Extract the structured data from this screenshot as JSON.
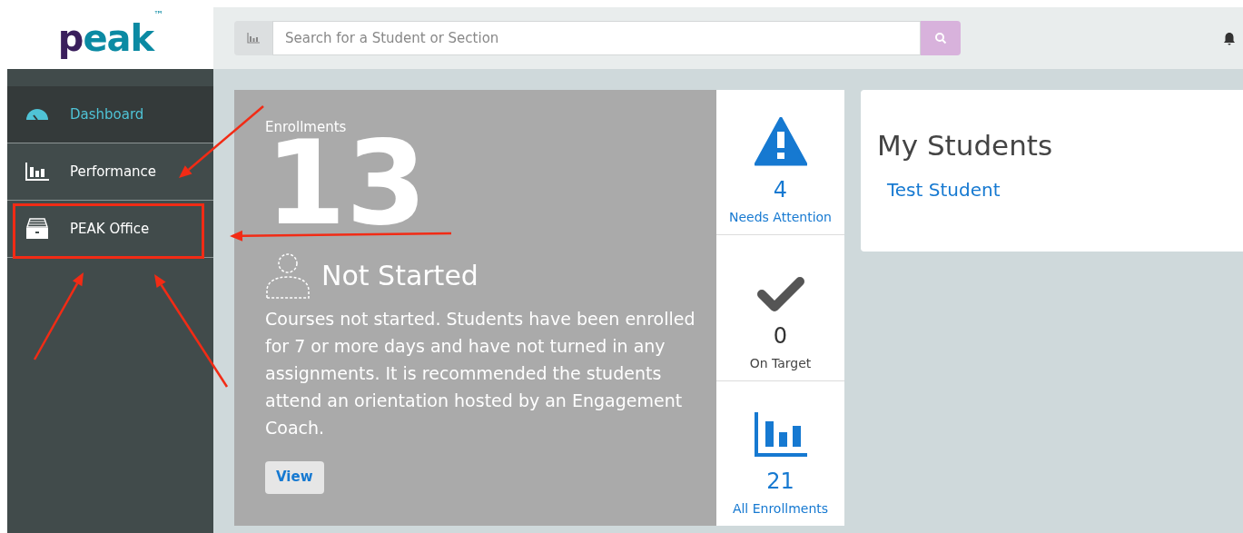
{
  "logo": {
    "text": "peak",
    "mark": "™"
  },
  "search": {
    "placeholder": "Search for a Student or Section"
  },
  "sidebar": {
    "items": [
      {
        "label": "Dashboard",
        "selected": true,
        "highlighted": false
      },
      {
        "label": "Performance",
        "selected": false,
        "highlighted": false
      },
      {
        "label": "PEAK Office",
        "selected": false,
        "highlighted": true
      }
    ]
  },
  "enrollments": {
    "label": "Enrollments",
    "count": "13",
    "status": "Not Started",
    "description": "Courses not started. Students have been enrolled for 7 or more days and have not turned in any assignments. It is recommended the students attend an orientation hosted by an Engagement Coach.",
    "button": "View"
  },
  "stats": [
    {
      "value": "4",
      "label": "Needs Attention",
      "kind": "link"
    },
    {
      "value": "0",
      "label": "On Target",
      "kind": "plain"
    },
    {
      "value": "21",
      "label": "All Enrollments",
      "kind": "link"
    }
  ],
  "my_students": {
    "title": "My Students",
    "students": [
      "Test Student"
    ]
  }
}
